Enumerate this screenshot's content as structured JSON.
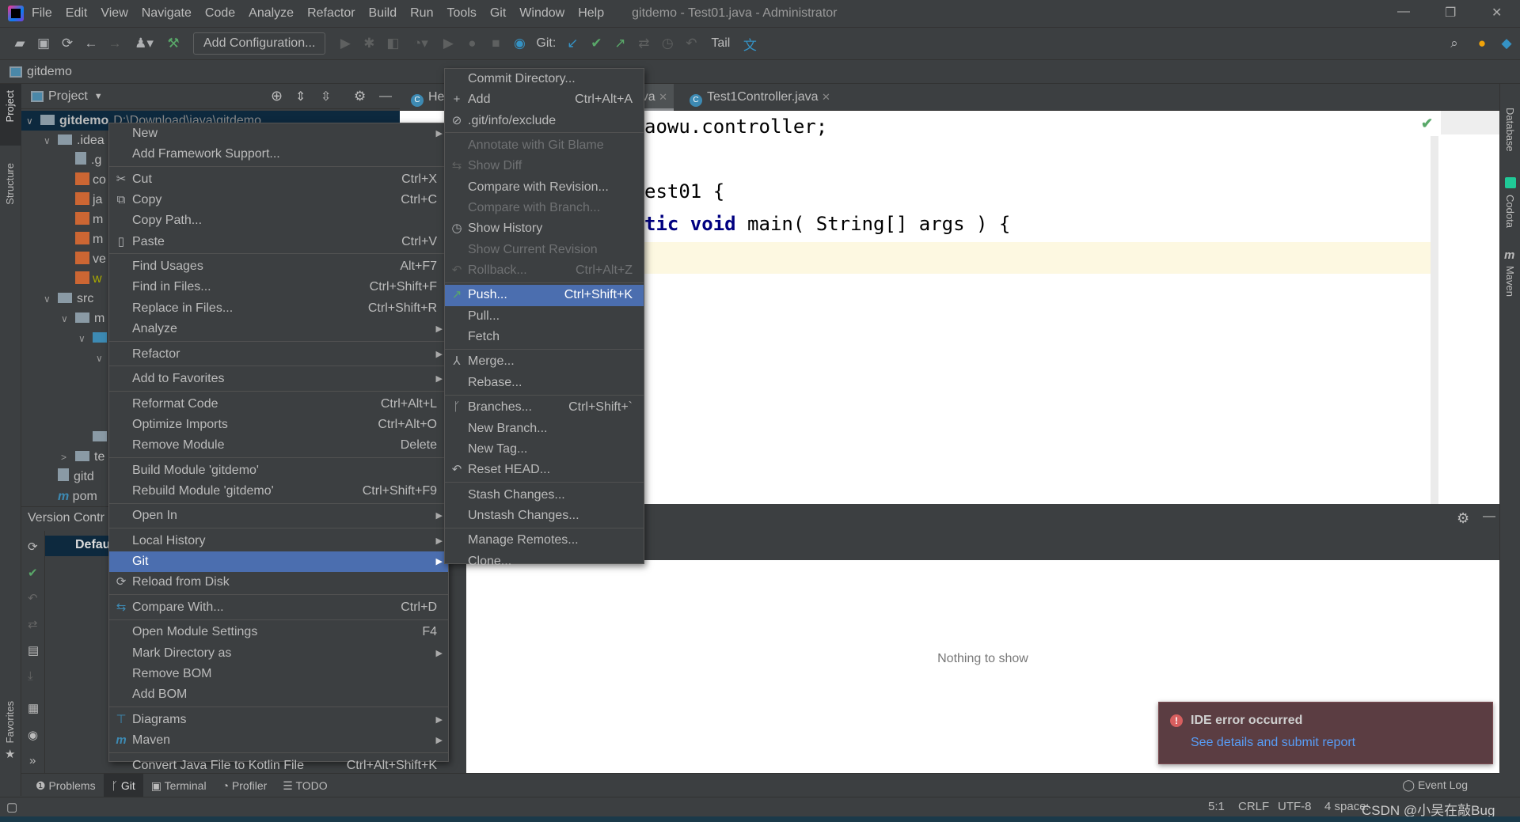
{
  "menubar": {
    "items": [
      "File",
      "Edit",
      "View",
      "Navigate",
      "Code",
      "Analyze",
      "Refactor",
      "Build",
      "Run",
      "Tools",
      "Git",
      "Window",
      "Help"
    ],
    "window_title": "gitdemo - Test01.java - Administrator"
  },
  "toolbar": {
    "add_configuration": "Add Configuration...",
    "git_label": "Git:",
    "tail": "Tail"
  },
  "navbar": {
    "project": "gitdemo"
  },
  "left_strip": {
    "project": "Project",
    "structure": "Structure",
    "favorites": "Favorites"
  },
  "right_strip": {
    "database": "Database",
    "codota": "Codota",
    "maven": "Maven"
  },
  "project_panel": {
    "title": "Project",
    "tree": [
      {
        "text": "gitdemo",
        "extra": "D:\\Download\\java\\gitdemo",
        "kind": "module",
        "expanded": true,
        "depth": 0,
        "selected": true
      },
      {
        "text": ".idea",
        "kind": "folder",
        "expanded": true,
        "depth": 1
      },
      {
        "text": ".g",
        "kind": "file",
        "depth": 2
      },
      {
        "text": "co",
        "kind": "xml",
        "depth": 2
      },
      {
        "text": "ja",
        "kind": "xml",
        "depth": 2
      },
      {
        "text": "m",
        "kind": "xml",
        "depth": 2
      },
      {
        "text": "m",
        "kind": "xml",
        "depth": 2
      },
      {
        "text": "ve",
        "kind": "xml",
        "depth": 2
      },
      {
        "text": "w",
        "kind": "xml",
        "depth": 2,
        "color": "#a8a800"
      },
      {
        "text": "src",
        "kind": "folder",
        "expanded": true,
        "depth": 1
      },
      {
        "text": "m",
        "kind": "folder",
        "expanded": true,
        "depth": 2
      },
      {
        "text": "",
        "kind": "folder-blue",
        "expanded": true,
        "depth": 3
      },
      {
        "text": "",
        "kind": "none",
        "expanded": true,
        "depth": 4
      },
      {
        "text": "",
        "kind": "none",
        "depth": 4
      },
      {
        "text": "",
        "kind": "none",
        "depth": 4
      },
      {
        "text": "",
        "kind": "none",
        "depth": 4
      },
      {
        "text": "",
        "kind": "folder",
        "depth": 3
      },
      {
        "text": "te",
        "kind": "folder",
        "expanded": false,
        "depth": 2
      },
      {
        "text": "gitd",
        "kind": "file",
        "depth": 1
      },
      {
        "text": "pom",
        "kind": "maven",
        "depth": 1
      }
    ]
  },
  "vc_panel": {
    "title": "Version Contr",
    "row": "Defau"
  },
  "editor": {
    "tabs": [
      {
        "label": "He"
      },
      {
        "label": "va",
        "active": true
      },
      {
        "label": "Test1Controller.java"
      }
    ],
    "lines": [
      {
        "plain": "aowu.controller;"
      },
      {
        "plain": "est01 {"
      },
      {
        "kw": "tic void",
        "plain": " main( String[] args ) {"
      }
    ]
  },
  "bottom_panel": {
    "empty_text": "Nothing to show"
  },
  "error_popup": {
    "title": "IDE error occurred",
    "link": "See details and submit report"
  },
  "tool_windows": [
    {
      "label": "Problems",
      "icon": "problems-icon"
    },
    {
      "label": "Git",
      "icon": "git-branch-icon",
      "active": true
    },
    {
      "label": "Terminal",
      "icon": "terminal-icon"
    },
    {
      "label": "Profiler",
      "icon": "profiler-icon"
    },
    {
      "label": "TODO",
      "icon": "todo-icon"
    }
  ],
  "event_log": "Event Log",
  "status": {
    "position": "5:1",
    "line_sep": "CRLF",
    "encoding": "UTF-8",
    "indent": "4 spaces",
    "watermark": "CSDN @小吴在敲Bug"
  },
  "context_menu": [
    {
      "label": "New",
      "submenu": true
    },
    {
      "label": "Add Framework Support..."
    },
    {
      "sep": true
    },
    {
      "label": "Cut",
      "shortcut": "Ctrl+X",
      "icon": "cut-icon"
    },
    {
      "label": "Copy",
      "shortcut": "Ctrl+C",
      "icon": "copy-icon"
    },
    {
      "label": "Copy Path..."
    },
    {
      "label": "Paste",
      "shortcut": "Ctrl+V",
      "icon": "paste-icon"
    },
    {
      "sep": true
    },
    {
      "label": "Find Usages",
      "shortcut": "Alt+F7"
    },
    {
      "label": "Find in Files...",
      "shortcut": "Ctrl+Shift+F"
    },
    {
      "label": "Replace in Files...",
      "shortcut": "Ctrl+Shift+R"
    },
    {
      "label": "Analyze",
      "submenu": true
    },
    {
      "sep": true
    },
    {
      "label": "Refactor",
      "submenu": true
    },
    {
      "sep": true
    },
    {
      "label": "Add to Favorites",
      "submenu": true
    },
    {
      "sep": true
    },
    {
      "label": "Reformat Code",
      "shortcut": "Ctrl+Alt+L"
    },
    {
      "label": "Optimize Imports",
      "shortcut": "Ctrl+Alt+O"
    },
    {
      "label": "Remove Module",
      "shortcut": "Delete"
    },
    {
      "sep": true
    },
    {
      "label": "Build Module 'gitdemo'"
    },
    {
      "label": "Rebuild Module 'gitdemo'",
      "shortcut": "Ctrl+Shift+F9"
    },
    {
      "sep": true
    },
    {
      "label": "Open In",
      "submenu": true
    },
    {
      "sep": true
    },
    {
      "label": "Local History",
      "submenu": true
    },
    {
      "label": "Git",
      "submenu": true,
      "selected": true
    },
    {
      "label": "Reload from Disk",
      "icon": "reload-icon"
    },
    {
      "sep": true
    },
    {
      "label": "Compare With...",
      "shortcut": "Ctrl+D",
      "icon": "compare-icon"
    },
    {
      "sep": true
    },
    {
      "label": "Open Module Settings",
      "shortcut": "F4"
    },
    {
      "label": "Mark Directory as",
      "submenu": true
    },
    {
      "label": "Remove BOM"
    },
    {
      "label": "Add BOM"
    },
    {
      "sep": true
    },
    {
      "label": "Diagrams",
      "submenu": true,
      "icon": "diagram-icon"
    },
    {
      "label": "Maven",
      "submenu": true,
      "icon": "maven-icon"
    },
    {
      "sep": true
    },
    {
      "label": "Convert Java File to Kotlin File",
      "shortcut": "Ctrl+Alt+Shift+K"
    }
  ],
  "git_submenu": [
    {
      "label": "Commit Directory..."
    },
    {
      "label": "Add",
      "shortcut": "Ctrl+Alt+A",
      "icon": "plus-icon"
    },
    {
      "label": ".git/info/exclude",
      "icon": "ignore-file-icon"
    },
    {
      "sep": true
    },
    {
      "label": "Annotate with Git Blame",
      "disabled": true
    },
    {
      "label": "Show Diff",
      "disabled": true,
      "icon": "diff-icon"
    },
    {
      "label": "Compare with Revision..."
    },
    {
      "label": "Compare with Branch...",
      "disabled": true
    },
    {
      "label": "Show History",
      "icon": "history-icon"
    },
    {
      "label": "Show Current Revision",
      "disabled": true
    },
    {
      "label": "Rollback...",
      "shortcut": "Ctrl+Alt+Z",
      "disabled": true,
      "icon": "rollback-icon"
    },
    {
      "sep": true
    },
    {
      "label": "Push...",
      "shortcut": "Ctrl+Shift+K",
      "selected": true,
      "icon": "push-icon"
    },
    {
      "label": "Pull..."
    },
    {
      "label": "Fetch"
    },
    {
      "sep": true
    },
    {
      "label": "Merge...",
      "icon": "merge-icon"
    },
    {
      "label": "Rebase..."
    },
    {
      "sep": true
    },
    {
      "label": "Branches...",
      "shortcut": "Ctrl+Shift+`",
      "icon": "branch-icon"
    },
    {
      "label": "New Branch..."
    },
    {
      "label": "New Tag..."
    },
    {
      "label": "Reset HEAD...",
      "icon": "reset-icon"
    },
    {
      "sep": true
    },
    {
      "label": "Stash Changes..."
    },
    {
      "label": "Unstash Changes..."
    },
    {
      "sep": true
    },
    {
      "label": "Manage Remotes..."
    },
    {
      "label": "Clone..."
    }
  ],
  "colors": {
    "selection": "#4b6eaf",
    "panel": "#3c3f41",
    "error_popup": "#5b3d42",
    "link": "#589df6",
    "keyword": "#000080"
  }
}
